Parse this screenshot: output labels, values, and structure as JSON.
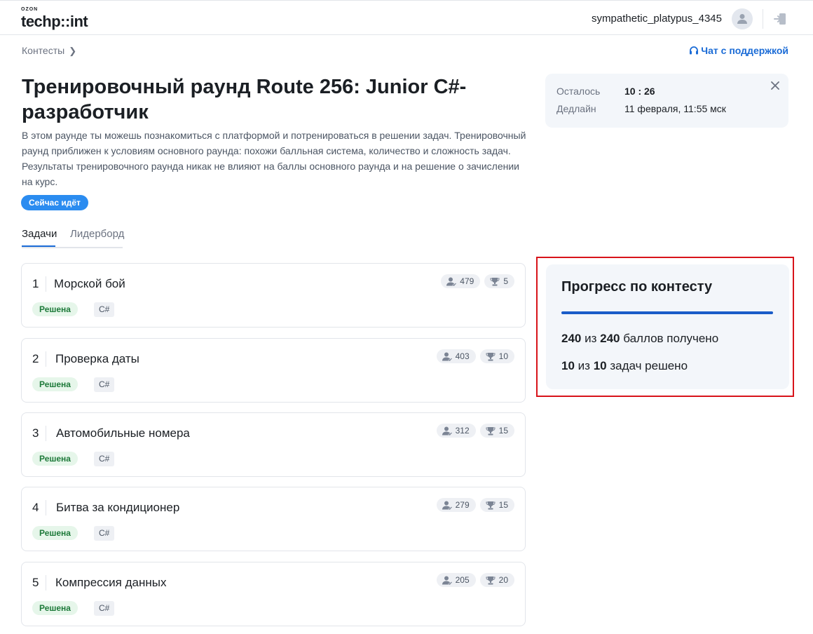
{
  "header": {
    "logo_small": "OZON",
    "logo_main": "techp::int",
    "username": "sympathetic_platypus_4345"
  },
  "breadcrumb": {
    "label": "Контесты"
  },
  "support": {
    "label": "Чат с поддержкой"
  },
  "contest": {
    "title": "Тренировочный раунд Route 256: Junior C#-разработчик",
    "description": "В этом раунде ты можешь познакомиться с платформой и потренироваться в решении задач. Тренировочный раунд приближен к условиям основного раунда: похожи балльная система, количество и сложность задач. Результаты тренировочного раунда никак не влияют на баллы основного раунда и на решение о зачислении на курс.",
    "status_badge": "Сейчас идёт"
  },
  "tabs": [
    {
      "label": "Задачи",
      "active": true
    },
    {
      "label": "Лидерборд",
      "active": false
    }
  ],
  "timer": {
    "remaining_label": "Осталось",
    "remaining_value": "10 : 26",
    "deadline_label": "Дедлайн",
    "deadline_value": "11 февраля, 11:55 мск"
  },
  "progress": {
    "title": "Прогресс по контесту",
    "fraction": 1.0,
    "points_got": "240",
    "points_of": "из",
    "points_total": "240",
    "points_suffix": "баллов получено",
    "tasks_got": "10",
    "tasks_of": "из",
    "tasks_total": "10",
    "tasks_suffix": "задач решено"
  },
  "tasks": [
    {
      "num": "1",
      "name": "Морской бой",
      "status": "Решена",
      "lang": "C#",
      "solvers": "479",
      "points": "5"
    },
    {
      "num": "2",
      "name": "Проверка даты",
      "status": "Решена",
      "lang": "C#",
      "solvers": "403",
      "points": "10"
    },
    {
      "num": "3",
      "name": "Автомобильные номера",
      "status": "Решена",
      "lang": "C#",
      "solvers": "312",
      "points": "15"
    },
    {
      "num": "4",
      "name": "Битва за кондиционер",
      "status": "Решена",
      "lang": "C#",
      "solvers": "279",
      "points": "15"
    },
    {
      "num": "5",
      "name": "Компрессия данных",
      "status": "Решена",
      "lang": "C#",
      "solvers": "205",
      "points": "20"
    }
  ],
  "colors": {
    "accent": "#1a6bd6",
    "badge_live": "#2b8cf0",
    "solved_bg": "#e6f6ea",
    "solved_text": "#1e7a3a",
    "highlight": "#d8131a"
  }
}
